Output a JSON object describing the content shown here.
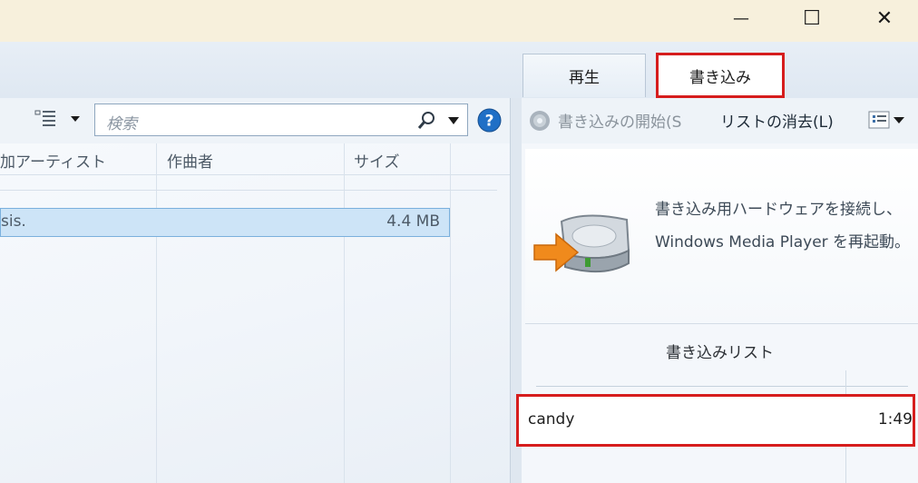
{
  "window": {
    "minimize_label": "—",
    "maximize_label": "☐",
    "close_label": "✕"
  },
  "tabs": [
    {
      "label": "再生",
      "selected": false
    },
    {
      "label": "書き込み",
      "selected": true
    }
  ],
  "library_toolbar": {
    "view_icon": "view-options-icon",
    "search_placeholder": "検索",
    "search_icon": "search-icon",
    "help_icon": "help-icon"
  },
  "columns": [
    "加アーティスト",
    "作曲者",
    "サイズ"
  ],
  "rows": [
    {
      "title": "sis.",
      "composer": "",
      "size": "4.4 MB"
    }
  ],
  "burn_toolbar": {
    "start_burn_label": "書き込みの開始(S",
    "clear_list_label": "リストの消去(L)",
    "options_icon": "list-options-icon"
  },
  "burn_info": {
    "line1": "書き込み用ハードウェアを接続し、",
    "line2": "Windows Media Player を再起動。"
  },
  "burn_list": {
    "title": "書き込みリスト",
    "items": [
      {
        "name": "candy",
        "duration": "1:49"
      }
    ]
  },
  "colors": {
    "highlight_border": "#d61d1d",
    "selection_fill": "#cde4f7",
    "help_blue": "#1f6fc6",
    "drive_arrow": "#f08a1c"
  }
}
